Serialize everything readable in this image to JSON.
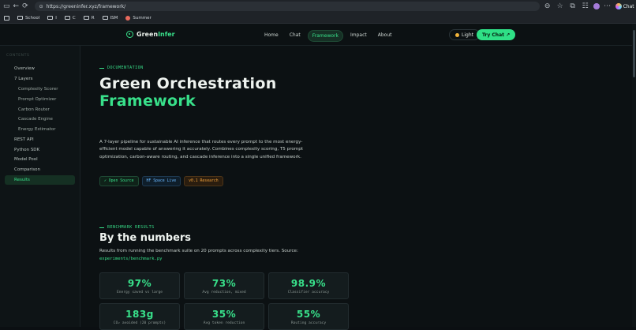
{
  "browser": {
    "url": "https://greeninfer.xyz/framework/",
    "chat_label": "Chat"
  },
  "bookmarks": [
    {
      "label": "School",
      "icon": "folder-icon"
    },
    {
      "label": "I",
      "icon": "folder-icon"
    },
    {
      "label": "C",
      "icon": "folder-icon"
    },
    {
      "label": "R",
      "icon": "folder-icon"
    },
    {
      "label": "ISM",
      "icon": "folder-icon"
    },
    {
      "label": "Summer",
      "icon": "bookmark-icon"
    }
  ],
  "nav": {
    "brand_a": "Green",
    "brand_b": "Infer",
    "links": [
      "Home",
      "Chat",
      "Framework",
      "Impact",
      "About"
    ],
    "active": "Framework",
    "theme_label": "Light",
    "cta_label": "Try Chat ↗"
  },
  "sidebar": {
    "heading": "CONTENTS",
    "items": [
      {
        "label": "Overview",
        "sub": false
      },
      {
        "label": "7 Layers",
        "sub": false
      },
      {
        "label": "Complexity Scorer",
        "sub": true
      },
      {
        "label": "Prompt Optimizer",
        "sub": true
      },
      {
        "label": "Carbon Router",
        "sub": true
      },
      {
        "label": "Cascade Engine",
        "sub": true
      },
      {
        "label": "Energy Estimator",
        "sub": true
      },
      {
        "label": "REST API",
        "sub": false
      },
      {
        "label": "Python SDK",
        "sub": false
      },
      {
        "label": "Model Pool",
        "sub": false
      },
      {
        "label": "Comparison",
        "sub": false
      },
      {
        "label": "Results",
        "sub": false,
        "active": true
      }
    ]
  },
  "hero": {
    "kicker": "DOCUMENTATION",
    "title_line1": "Green Orchestration",
    "title_line2": "Framework",
    "description": "A 7-layer pipeline for sustainable AI inference that routes every prompt to the most energy-efficient model capable of answering it accurately. Combines complexity scoring, T5 prompt optimization, carbon-aware routing, and cascade inference into a single unified framework.",
    "tags": [
      "✓ Open Source",
      "HF Space Live",
      "v0.1 Research"
    ]
  },
  "results": {
    "kicker": "BENCHMARK RESULTS",
    "title": "By the numbers",
    "subtitle": "Results from running the benchmark suite on 20 prompts across complexity tiers. Source:",
    "source_link": "experiments/benchmark.py",
    "stats": [
      {
        "value": "97%",
        "label": "Energy saved vs large"
      },
      {
        "value": "73%",
        "label": "Avg reduction, mixed"
      },
      {
        "value": "98.9%",
        "label": "Classifier accuracy"
      },
      {
        "value": "183g",
        "label": "CO₂ avoided (20 prompts)"
      },
      {
        "value": "35%",
        "label": "Avg token reduction"
      },
      {
        "value": "55%",
        "label": "Routing accuracy"
      }
    ]
  },
  "colors": {
    "accent": "#38e08a",
    "background": "#0c1113"
  }
}
